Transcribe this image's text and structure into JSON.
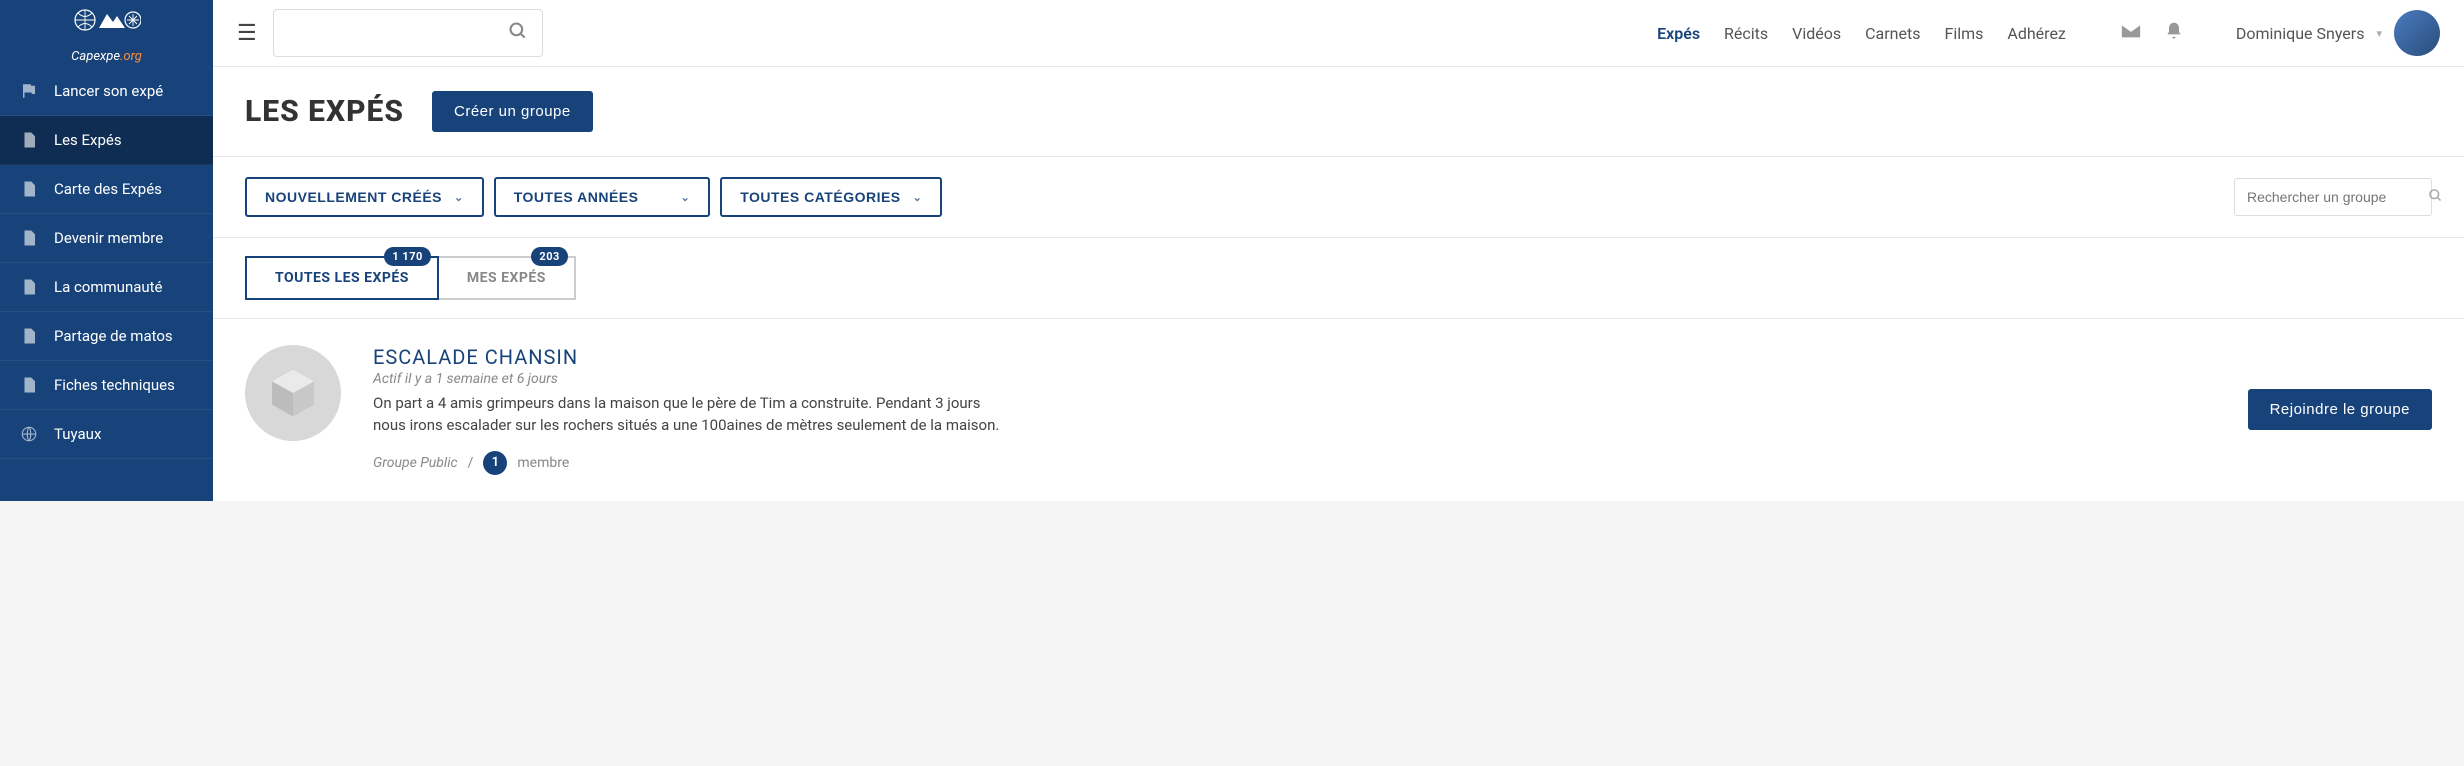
{
  "brand": {
    "name": "Capexpe",
    "suffix": ".org"
  },
  "sidebar": {
    "items": [
      {
        "label": "Lancer son expé",
        "icon": "flag-icon"
      },
      {
        "label": "Les Expés",
        "icon": "document-icon"
      },
      {
        "label": "Carte des Expés",
        "icon": "document-icon"
      },
      {
        "label": "Devenir membre",
        "icon": "document-icon"
      },
      {
        "label": "La communauté",
        "icon": "document-icon"
      },
      {
        "label": "Partage de matos",
        "icon": "document-icon"
      },
      {
        "label": "Fiches techniques",
        "icon": "document-icon"
      },
      {
        "label": "Tuyaux",
        "icon": "globe-icon"
      }
    ],
    "active_index": 1
  },
  "topnav": {
    "items": [
      {
        "label": "Expés",
        "primary": true
      },
      {
        "label": "Récits"
      },
      {
        "label": "Vidéos"
      },
      {
        "label": "Carnets"
      },
      {
        "label": "Films"
      },
      {
        "label": "Adhérez"
      }
    ]
  },
  "user": {
    "name": "Dominique Snyers"
  },
  "page": {
    "title": "LES EXPÉS",
    "create_button": "Créer un groupe"
  },
  "filters": {
    "sort": "NOUVELLEMENT CRÉÉS",
    "years": "TOUTES ANNÉES",
    "categories": "TOUTES CATÉGORIES"
  },
  "group_search": {
    "placeholder": "Rechercher un groupe"
  },
  "tabs": {
    "all": {
      "label": "TOUTES LES EXPÉS",
      "count": "1 170"
    },
    "mine": {
      "label": "MES EXPÉS",
      "count": "203"
    }
  },
  "group": {
    "title": "ESCALADE CHANSIN",
    "activity": "Actif il y a 1 semaine et 6 jours",
    "description": "On part a 4 amis grimpeurs dans la maison que le père de Tim a construite. Pendant 3 jours nous irons escalader sur les rochers situés a une 100aines de mètres seulement de la maison.",
    "visibility": "Groupe Public",
    "separator": "/",
    "member_count": "1",
    "member_label": "membre",
    "join_button": "Rejoindre le groupe"
  }
}
